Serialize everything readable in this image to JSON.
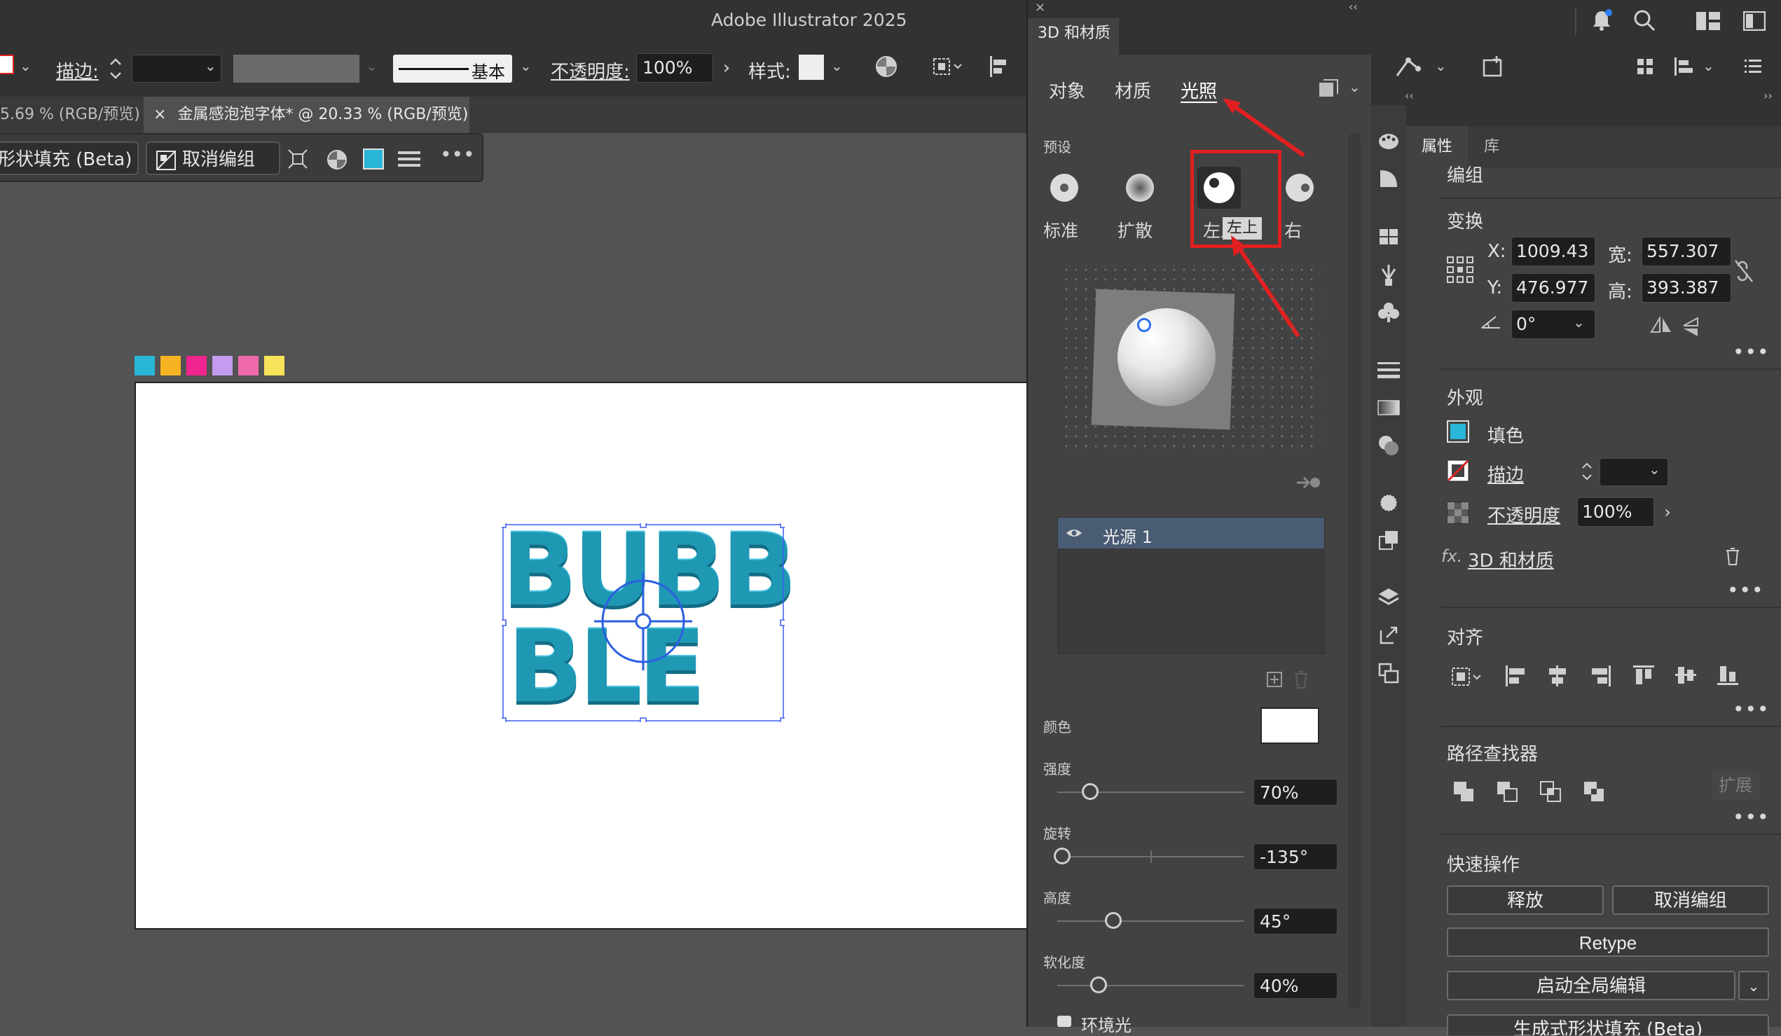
{
  "app": {
    "title": "Adobe Illustrator 2025"
  },
  "control_bar": {
    "stroke_label": "描边:",
    "stroke_style": "基本",
    "opacity_label": "不透明度:",
    "opacity_value": "100%",
    "style_label": "样式:"
  },
  "doc_tabs": [
    {
      "label": "5.69 % (RGB/预览)"
    },
    {
      "close": "×",
      "label": "金属感泡泡字体* @ 20.33 % (RGB/预览)"
    }
  ],
  "context_bar": {
    "shape_fill": "形状填充 (Beta)",
    "ungroup": "取消编组",
    "more": "•••"
  },
  "swatches": [
    "#29b6d8",
    "#f7b322",
    "#f0258f",
    "#c49bef",
    "#ef6aa8",
    "#f7e35a"
  ],
  "artwork": {
    "line1": "BUBB",
    "line2": "BLE",
    "fill": "#1f98b4"
  },
  "panel_3d": {
    "close": "×",
    "collapse": "‹‹",
    "title": "3D 和材质",
    "tabs": [
      "对象",
      "材质",
      "光照"
    ],
    "active_tab": "光照",
    "preset_label": "预设",
    "presets": [
      "标准",
      "扩散",
      "左上",
      "右"
    ],
    "tooltip": "左上",
    "light_item": "光源 1",
    "color_label": "颜色",
    "intensity_label": "强度",
    "intensity_value": "70%",
    "intensity": 0.7,
    "rotation_label": "旋转",
    "rotation_value": "-135°",
    "rotation": -135,
    "height_label": "高度",
    "height_value": "45°",
    "height": 45,
    "softness_label": "软化度",
    "softness_value": "40%",
    "softness": 0.4,
    "ambient_label": "环境光",
    "ambient_checked": true,
    "highlight_color": "#e02020"
  },
  "props_panel": {
    "tabs": [
      "属性",
      "库"
    ],
    "group_label": "编组",
    "transform_label": "变换",
    "x_label": "X:",
    "x_value": "1009.43",
    "y_label": "Y:",
    "y_value": "476.977",
    "w_label": "宽:",
    "w_value": "557.307",
    "h_label": "高:",
    "h_value": "393.387",
    "angle_value": "0°",
    "appearance_label": "外观",
    "fill_label": "填色",
    "stroke_label": "描边",
    "opacity_label": "不透明度",
    "opacity_value": "100%",
    "fx_label": "3D 和材质",
    "align_label": "对齐",
    "pathfinder_label": "路径查找器",
    "expand_label": "扩展",
    "quick_actions_label": "快速操作",
    "release": "释放",
    "ungroup": "取消编组",
    "retype": "Retype",
    "global_edit": "启动全局编辑",
    "generative": "生成式形状填充 (Beta)",
    "fill_color": "#29b6d8"
  }
}
